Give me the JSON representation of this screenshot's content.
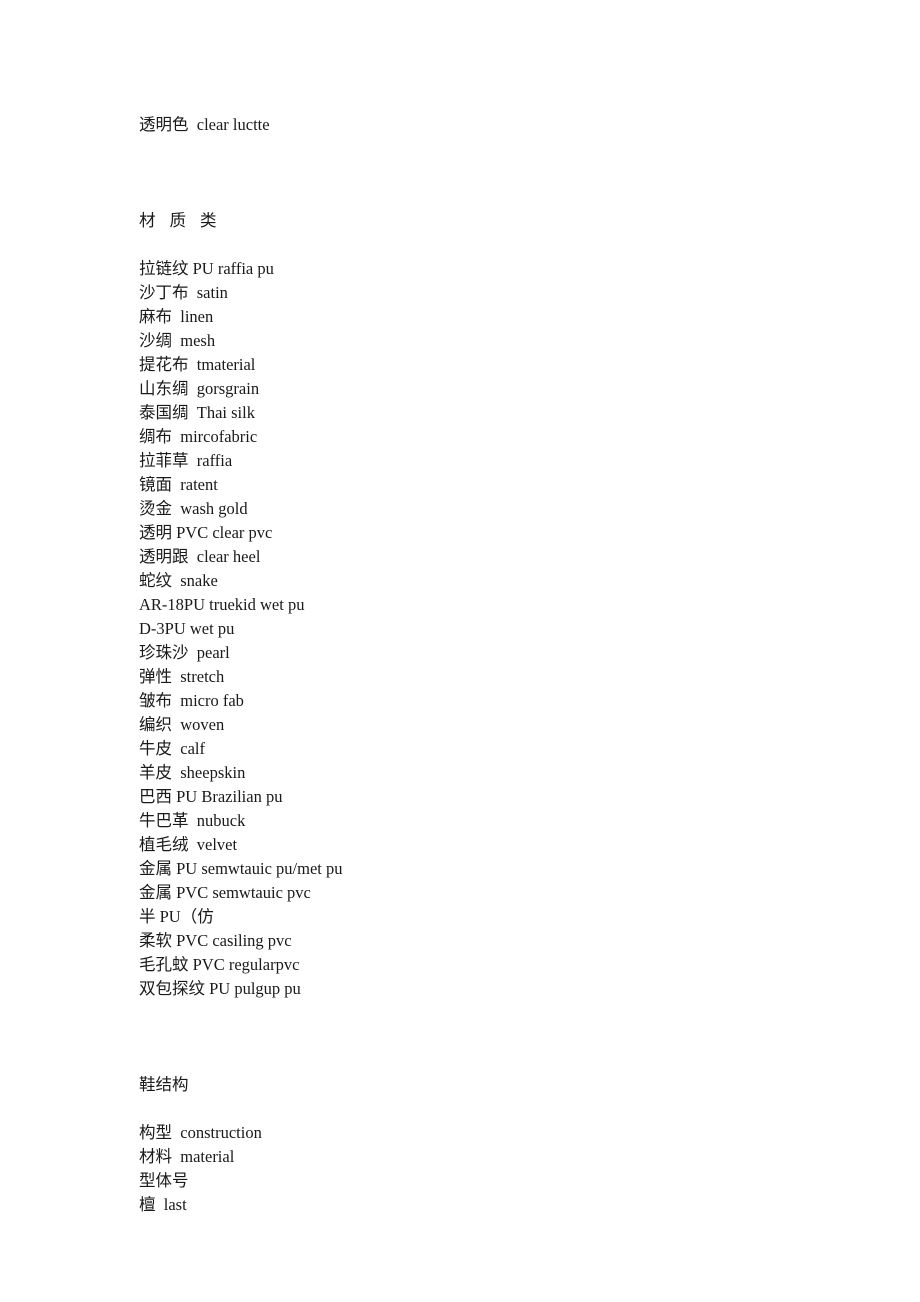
{
  "document": {
    "background_color": "#ffffff",
    "text_color": "#1a1a1a",
    "intro_line": "透明色  clear luctte",
    "sections": [
      {
        "heading": "材 质 类",
        "heading_style": "spaced",
        "entries": [
          "拉链纹 PU raffia pu",
          "沙丁布  satin",
          "麻布  linen",
          "沙绸  mesh",
          "提花布  tmaterial",
          "山东绸  gorsgrain",
          "泰国绸  Thai silk",
          "绸布  mircofabric",
          "拉菲草  raffia",
          "镜面  ratent",
          "烫金  wash gold",
          "透明 PVC clear pvc",
          "透明跟  clear heel",
          "蛇纹  snake",
          "AR-18PU truekid wet pu",
          "D-3PU wet pu",
          "珍珠沙  pearl",
          "弹性  stretch",
          "皱布  micro fab",
          "编织  woven",
          "牛皮  calf",
          "羊皮  sheepskin",
          "巴西 PU Brazilian pu",
          "牛巴革  nubuck",
          "植毛绒  velvet",
          "金属 PU semwtauic pu/met pu",
          "金属 PVC semwtauic pvc",
          "半 PU（仿",
          "柔软 PVC casiling pvc",
          "毛孔蚊 PVC regularpvc",
          "双包探纹 PU pulgup pu"
        ]
      },
      {
        "heading": "鞋结构",
        "heading_style": "plain",
        "entries": [
          "构型  construction",
          "材料  material",
          "型体号",
          "檀  last"
        ]
      }
    ]
  }
}
